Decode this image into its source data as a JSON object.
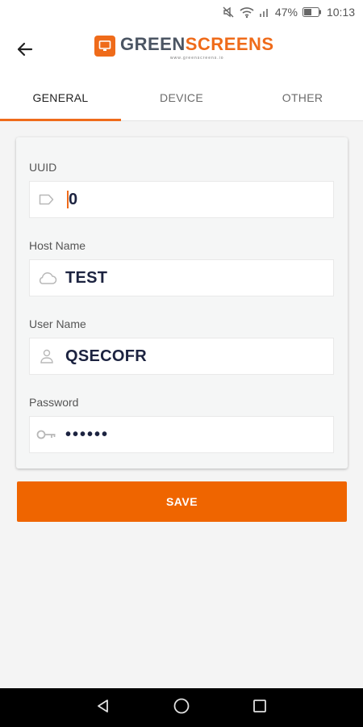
{
  "status_bar": {
    "battery": "47%",
    "time": "10:13",
    "icons": [
      "mute-icon",
      "wifi-icon",
      "signal-icon",
      "battery-icon"
    ]
  },
  "header": {
    "back_icon": "arrow-left-icon",
    "logo": {
      "word1": "GREEN",
      "word2": "SCREENS",
      "url": "www.greenscreens.io"
    }
  },
  "tabs": [
    {
      "label": "GENERAL",
      "active": true
    },
    {
      "label": "DEVICE",
      "active": false
    },
    {
      "label": "OTHER",
      "active": false
    }
  ],
  "form": {
    "uuid": {
      "label": "UUID",
      "value": "0",
      "icon": "tag-icon"
    },
    "host_name": {
      "label": "Host Name",
      "value": "TEST",
      "icon": "cloud-icon"
    },
    "user_name": {
      "label": "User Name",
      "value": "QSECOFR",
      "icon": "person-icon"
    },
    "password": {
      "label": "Password",
      "value": "••••••",
      "icon": "key-icon"
    }
  },
  "save_button": {
    "label": "SAVE"
  },
  "colors": {
    "accent": "#ef6500",
    "logo_gray": "#4b5563",
    "value_text": "#1c2340"
  },
  "nav_bar": {
    "icons": [
      "back-triangle-icon",
      "home-circle-icon",
      "recents-square-icon"
    ]
  }
}
